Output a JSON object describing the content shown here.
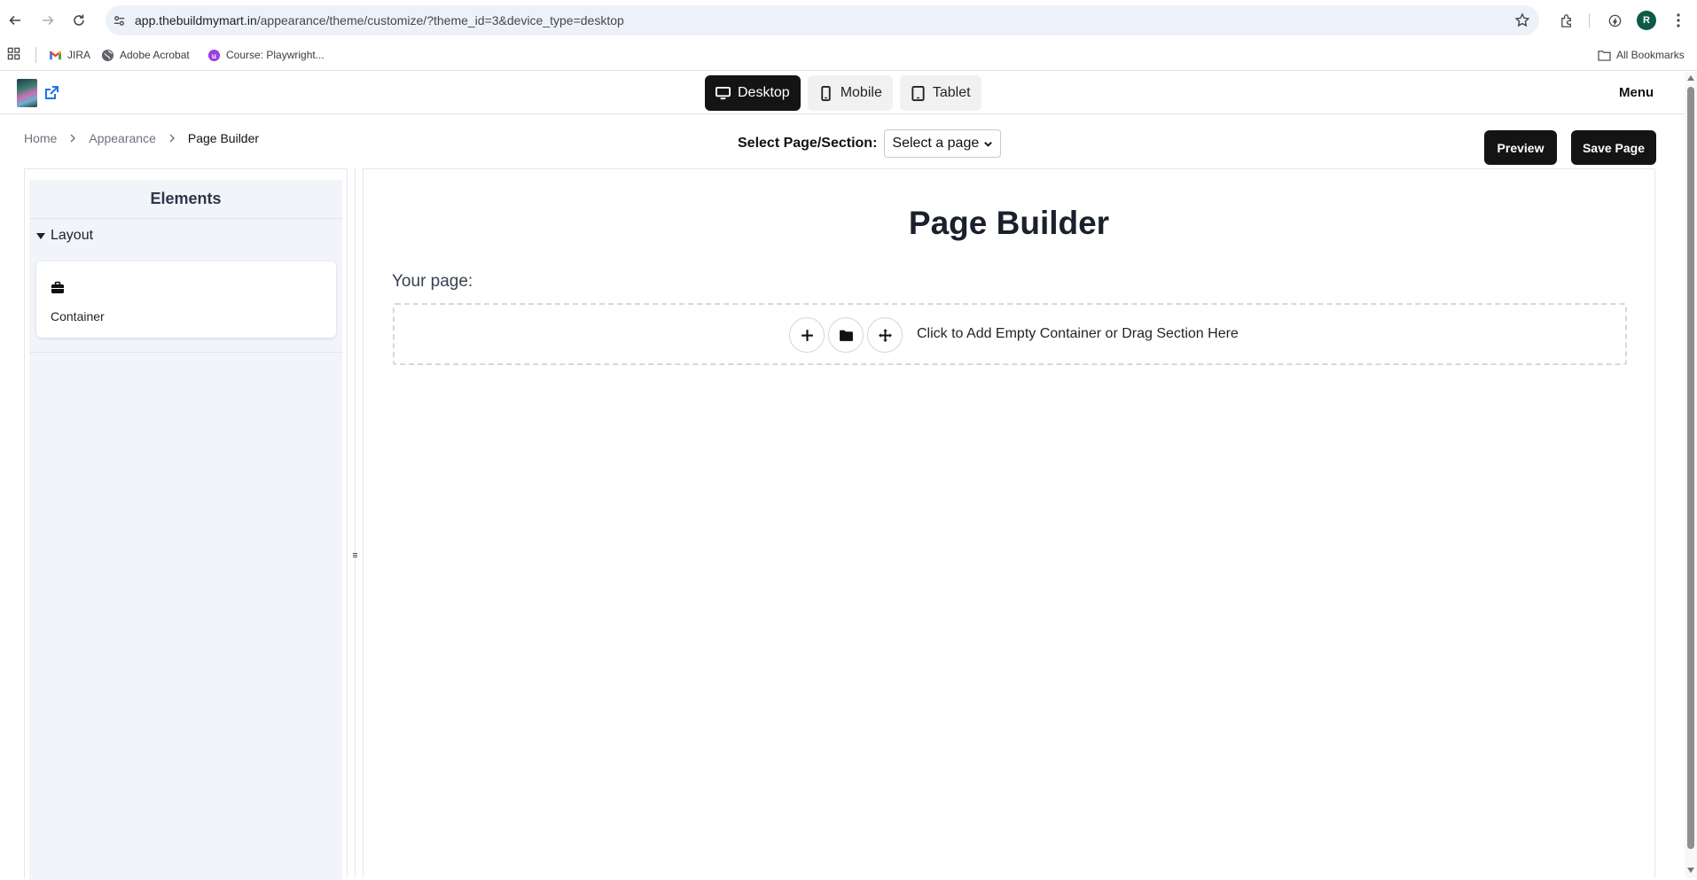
{
  "browser": {
    "url_host": "app.thebuildmymart.in",
    "url_path": "/appearance/theme/customize/?theme_id=3&device_type=desktop",
    "profile_initial": "R",
    "bookmarks": [
      {
        "label": "JIRA",
        "icon": "gmail-icon"
      },
      {
        "label": "Adobe Acrobat",
        "icon": "globe-icon"
      },
      {
        "label": "Course: Playwright...",
        "icon": "course-icon"
      }
    ],
    "all_bookmarks": "All Bookmarks"
  },
  "header": {
    "device_tabs": [
      {
        "label": "Desktop",
        "icon": "desktop-icon",
        "active": true
      },
      {
        "label": "Mobile",
        "icon": "mobile-icon",
        "active": false
      },
      {
        "label": "Tablet",
        "icon": "tablet-icon",
        "active": false
      }
    ],
    "menu_label": "Menu"
  },
  "breadcrumb": [
    "Home",
    "Appearance",
    "Page Builder"
  ],
  "page_select": {
    "label": "Select Page/Section:",
    "selected": "Select a page"
  },
  "actions": {
    "preview_label": "Preview",
    "save_label": "Save Page"
  },
  "sidebar": {
    "title": "Elements",
    "groups": [
      {
        "label": "Layout",
        "items": [
          {
            "label": "Container",
            "icon": "briefcase-icon"
          }
        ]
      }
    ]
  },
  "canvas": {
    "title": "Page Builder",
    "subtitle": "Your page:",
    "drop_zone_text": "Click to Add Empty Container or Drag Section Here"
  },
  "colors": {
    "primary_dark": "#141414",
    "sidebar_bg": "#f1f4f9",
    "omnibox_bg": "#edf2fa",
    "link_blue": "#1a73e8"
  }
}
